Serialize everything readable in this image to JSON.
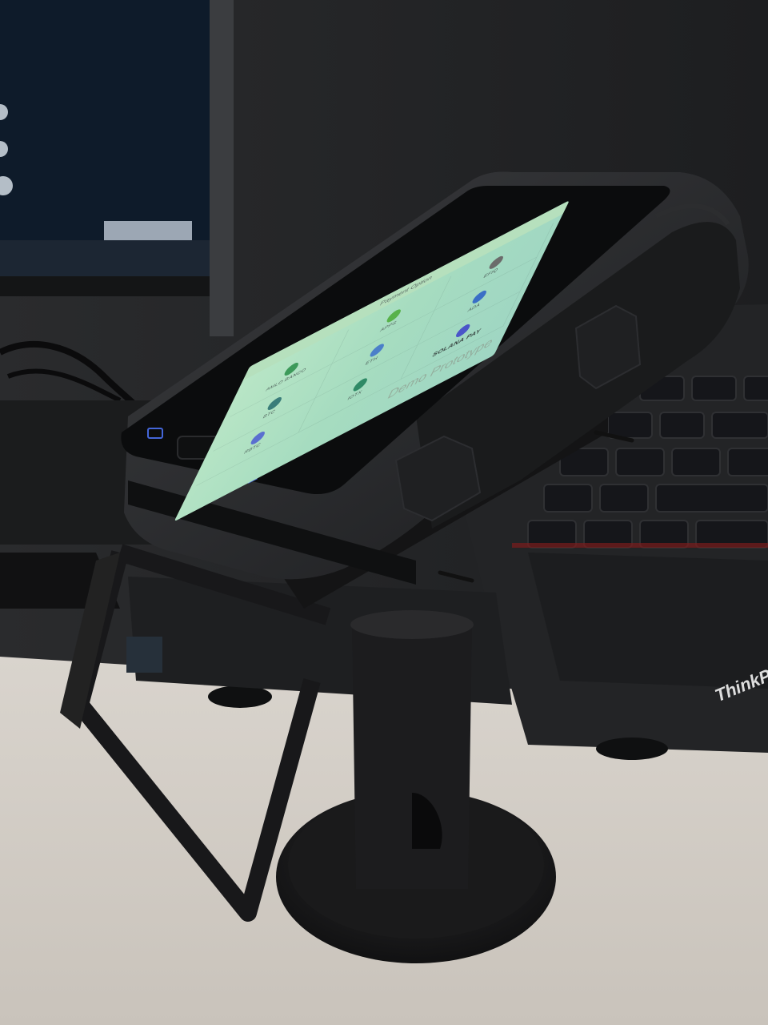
{
  "screen": {
    "header_title": "Payment Option",
    "watermark": "Demo Prototype",
    "options": [
      {
        "label": "AMLO BANCO",
        "color": "#3c9a5a",
        "icon": "bank-icon"
      },
      {
        "label": "APPS",
        "color": "#58b24a",
        "icon": "apps-icon"
      },
      {
        "label": "EFIQ",
        "color": "#6b6b6b",
        "icon": "efiq-icon"
      },
      {
        "label": "BTC",
        "color": "#3a7d7a",
        "icon": "bitcoin-icon"
      },
      {
        "label": "ETH",
        "color": "#4b7fc9",
        "icon": "ethereum-icon"
      },
      {
        "label": "ADA",
        "color": "#3a6fc6",
        "icon": "cardano-icon"
      },
      {
        "label": "RBTC",
        "color": "#5a6fd0",
        "icon": "rbtc-icon"
      },
      {
        "label": "IOTX",
        "color": "#2f8a66",
        "icon": "iotex-icon"
      },
      {
        "label": "SOLANA PAY",
        "color": "#4a55c9",
        "icon": "solana-icon"
      }
    ]
  },
  "laptop": {
    "brand": "ThinkPad"
  }
}
